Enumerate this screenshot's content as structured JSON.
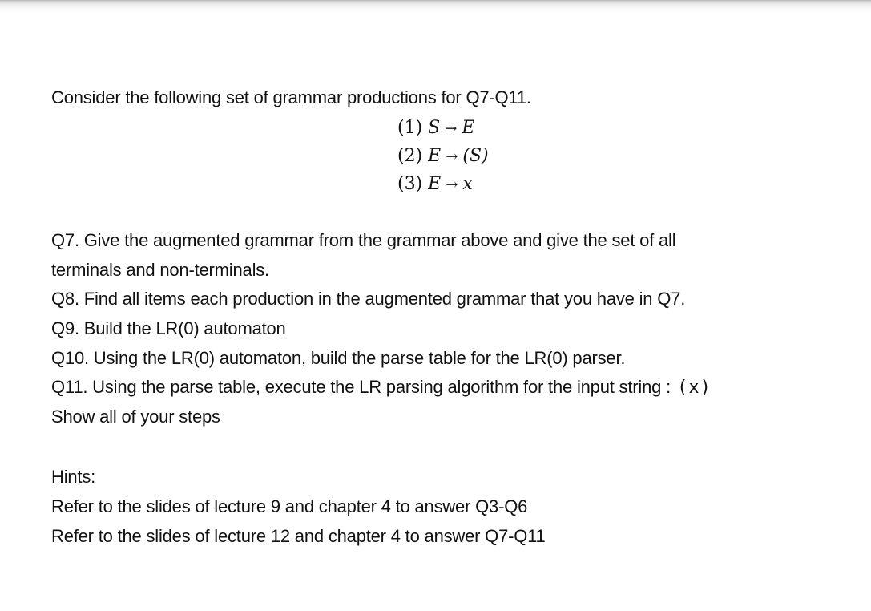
{
  "document": {
    "intro": "Consider the following set of grammar productions for Q7-Q11.",
    "productions": [
      {
        "number": "(1)",
        "lhs": "S",
        "arrow": "→",
        "rhs": "E"
      },
      {
        "number": "(2)",
        "lhs": "E",
        "arrow": "→",
        "rhs": "(S)"
      },
      {
        "number": "(3)",
        "lhs": "E",
        "arrow": "→",
        "rhs": "x"
      }
    ],
    "questions": {
      "q7_line1": "Q7. Give the augmented grammar from the grammar above and give the set of all",
      "q7_line2": "terminals and non-terminals.",
      "q8": "Q8. Find all items each production in the augmented grammar that you have in Q7.",
      "q9": "Q9. Build the LR(0) automaton",
      "q10": "Q10. Using the LR(0) automaton, build the parse table for the LR(0) parser.",
      "q11_text": "Q11. Using the parse table, execute the LR parsing algorithm for the input string",
      "q11_colon": ":",
      "q11_input": "(x)",
      "q11_steps": "Show all of your steps"
    },
    "hints": {
      "title": "Hints:",
      "items": [
        "Refer to the slides of lecture 9 and chapter 4 to answer Q3-Q6",
        "Refer to the slides of lecture 12 and chapter 4 to answer Q7-Q11"
      ]
    }
  }
}
